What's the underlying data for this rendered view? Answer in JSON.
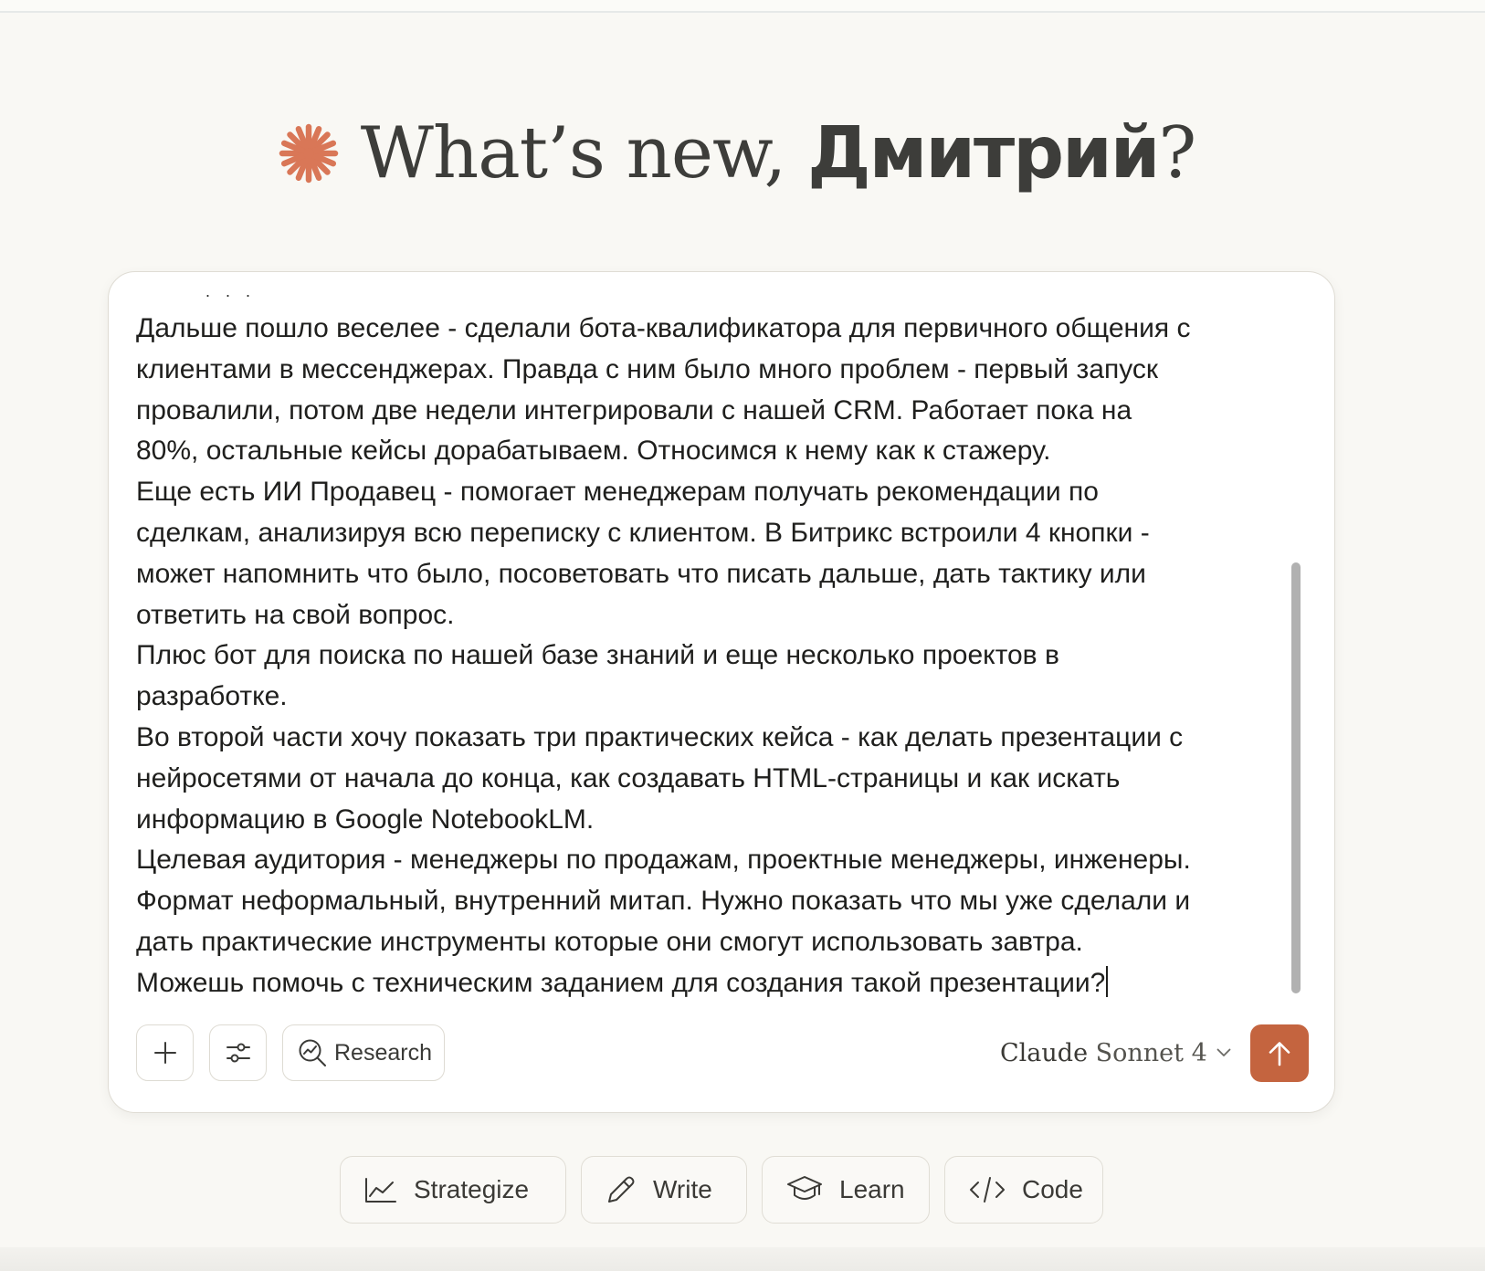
{
  "greeting": {
    "prefix": "What’s new, ",
    "name": "Дмитрий",
    "suffix": "?",
    "icon": "claude-spark-icon",
    "icon_color": "#d97757"
  },
  "composer": {
    "clipped_first_line": ". . .",
    "lines": [
      "Дальше пошло веселее - сделали бота-квалификатора для первичного общения с",
      "клиентами в мессенджерах. Правда с ним было много проблем - первый запуск",
      "провалили, потом две недели интегрировали с нашей CRM. Работает пока на",
      "80%, остальные кейсы дорабатываем. Относимся к нему как к стажеру.",
      "Еще есть ИИ Продавец - помогает менеджерам получать рекомендации по",
      "сделкам, анализируя всю переписку с клиентом. В Битрикс встроили 4 кнопки -",
      "может напомнить что было, посоветовать что писать дальше, дать тактику или",
      "ответить на свой вопрос.",
      "Плюс бот для поиска по нашей базе знаний и еще несколько проектов в",
      "разработке.",
      "Во второй части хочу показать три практических кейса - как делать презентации с",
      "нейросетями от начала до конца, как создавать HTML-страницы и как искать",
      "информацию в Google NotebookLM.",
      "Целевая аудитория - менеджеры по продажам, проектные менеджеры, инженеры.",
      "Формат неформальный, внутренний митап. Нужно показать что мы уже сделали и",
      "дать практические инструменты которые они смогут использовать завтра.",
      "Можешь помочь с техническим заданием для создания такой презентации?"
    ],
    "toolbar": {
      "add_icon": "plus-icon",
      "settings_icon": "sliders-icon",
      "research_icon": "research-icon",
      "research_label": "Research"
    },
    "model": {
      "brand": "Claude",
      "name": "Sonnet 4",
      "icon": "chevron-down-icon"
    },
    "send": {
      "icon": "arrow-up-icon",
      "color": "#c4643f"
    }
  },
  "actions": [
    {
      "label": "Strategize",
      "icon": "trend-chart-icon"
    },
    {
      "label": "Write",
      "icon": "pencil-icon"
    },
    {
      "label": "Learn",
      "icon": "graduation-cap-icon"
    },
    {
      "label": "Code",
      "icon": "code-icon"
    }
  ]
}
